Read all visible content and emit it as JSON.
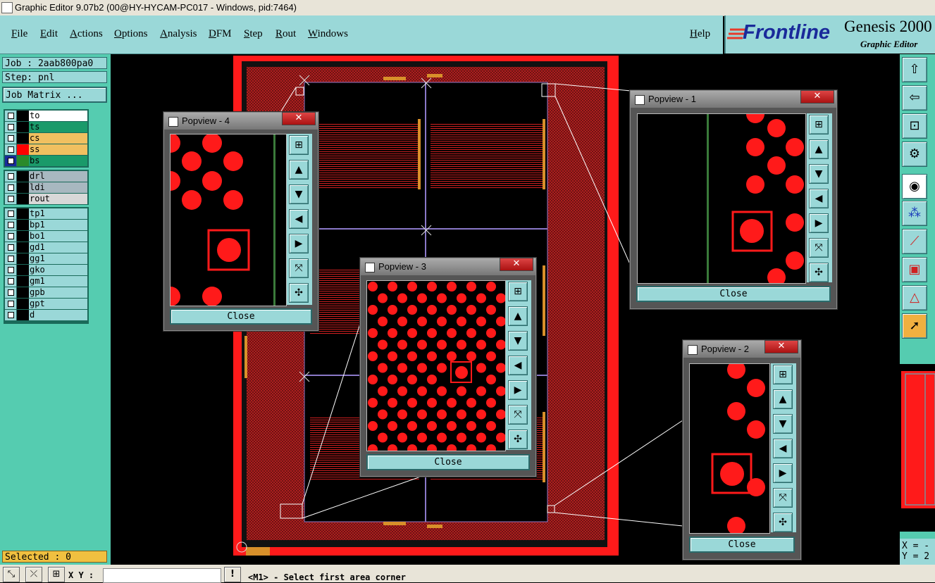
{
  "window": {
    "title": "Graphic Editor 9.07b2 (00@HY-HYCAM-PC017 - Windows, pid:7464)"
  },
  "menu": {
    "items": [
      "File",
      "Edit",
      "Actions",
      "Options",
      "Analysis",
      "DFM",
      "Step",
      "Rout",
      "Windows"
    ],
    "help": "Help"
  },
  "logo": {
    "brand": "Frontline",
    "product": "Genesis 2000",
    "subtitle": "Graphic Editor"
  },
  "job": {
    "job_label": "Job : 2aab800pa0",
    "step_label": "Step: pnl",
    "matrix_button": "Job Matrix ..."
  },
  "layers": {
    "group1": [
      {
        "name": "to",
        "swatch": "#000000",
        "bg": "#ffffff"
      },
      {
        "name": "ts",
        "swatch": "#000000",
        "bg": "#1a9a6a"
      },
      {
        "name": "cs",
        "swatch": "#000000",
        "bg": "#f0c060"
      },
      {
        "name": "ss",
        "swatch": "#ff0000",
        "bg": "#f0c060"
      },
      {
        "name": "bs",
        "swatch": "#2a8a2a",
        "bg": "#1a9a6a"
      }
    ],
    "group2": [
      {
        "name": "drl",
        "bg": "#a8b8c0"
      },
      {
        "name": "ldi",
        "bg": "#a8b8c0"
      },
      {
        "name": "rout",
        "bg": "#d8d8d8"
      }
    ],
    "group3": [
      {
        "name": "tp1"
      },
      {
        "name": "bp1"
      },
      {
        "name": "bo1"
      },
      {
        "name": "gd1"
      },
      {
        "name": "gg1"
      },
      {
        "name": "gko"
      },
      {
        "name": "gm1"
      },
      {
        "name": "gpb"
      },
      {
        "name": "gpt"
      },
      {
        "name": "d"
      }
    ]
  },
  "selected": "Selected : 0",
  "popviews": [
    {
      "title": "Popview - 4",
      "close": "Close"
    },
    {
      "title": "Popview - 3",
      "close": "Close"
    },
    {
      "title": "Popview - 1",
      "close": "Close"
    },
    {
      "title": "Popview - 2",
      "close": "Close"
    }
  ],
  "status": {
    "xy_label": "X Y :",
    "xy_value": "",
    "prompt": "<M1> - Select first area corner"
  },
  "coords": {
    "x": "X = -",
    "y": "Y = 2"
  },
  "icons": {
    "popview_tools": [
      "zoom-fit-icon",
      "pan-up-icon",
      "pan-down-icon",
      "pan-left-icon",
      "pan-right-icon",
      "zoom-in-icon",
      "zoom-out-icon"
    ],
    "right_tools": [
      "home-icon",
      "pan-icon",
      "zoom-fit-icon",
      "snap-icon",
      "feature-select-icon",
      "net-icon",
      "measure-icon",
      "highlight-icon",
      "drc-icon",
      "pointer-icon"
    ]
  },
  "colors": {
    "pcb_red": "#ff1a1a",
    "ui_teal": "#9ad8d8",
    "panel_green": "#55ccb0",
    "outline_purple": "#8a78c8"
  }
}
